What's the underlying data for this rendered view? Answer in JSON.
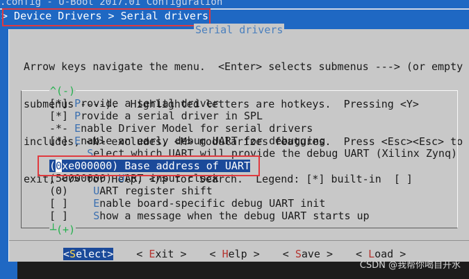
{
  "window": {
    "title": ".config - U-Boot 2017.01 Configuration",
    "breadcrumb": "> Device Drivers > Serial drivers"
  },
  "dialog": {
    "title": "Serial drivers",
    "help_lines": [
      "Arrow keys navigate the menu.  <Enter> selects submenus ---> (or empty",
      "submenus ----).  Highlighted letters are hotkeys.  Pressing <Y>",
      "includes, <N> excludes, <M> modularizes features.  Press <Esc><Esc> to",
      "exit, <?> for Help, </> for Search.  Legend: [*] built-in  [ ]"
    ],
    "scroll_up_marker": "^(-)",
    "scroll_down_marker": "┴(+)",
    "items": [
      {
        "prefix": "[*] ",
        "hotkey": "P",
        "rest": "rovide a serial driver",
        "selected": false
      },
      {
        "prefix": "[*] ",
        "hotkey": "P",
        "rest": "rovide a serial driver in SPL",
        "selected": false
      },
      {
        "prefix": "-*- ",
        "hotkey": "E",
        "rest": "nable Driver Model for serial drivers",
        "selected": false
      },
      {
        "prefix": "[*] ",
        "hotkey": "E",
        "rest": "nable an early debug UART for debugging",
        "selected": false
      },
      {
        "prefix": "      ",
        "hotkey": "S",
        "rest": "elect which UART will provide the debug UART (Xilinx Zynq)",
        "selected": false
      },
      {
        "prefix": "(",
        "cursor": "0",
        "prefix2": "xe000000) ",
        "hotkey": "B",
        "rest": "ase address of UART",
        "selected": true
      },
      {
        "prefix": "(50000000) ",
        "hotkey": "U",
        "rest": "ART input clock",
        "selected": false
      },
      {
        "prefix": "(0)    ",
        "hotkey": "U",
        "rest": "ART register shift",
        "selected": false
      },
      {
        "prefix": "[ ]    ",
        "hotkey": "E",
        "rest": "nable board-specific debug UART init",
        "selected": false
      },
      {
        "prefix": "[ ]    ",
        "hotkey": "S",
        "rest": "how a message when the debug UART starts up",
        "selected": false
      }
    ],
    "buttons": [
      {
        "lead": "<",
        "hot": "S",
        "rest": "elect>",
        "active": true
      },
      {
        "lead": "< ",
        "hot": "E",
        "rest": "xit >",
        "active": false
      },
      {
        "lead": "< ",
        "hot": "H",
        "rest": "elp >",
        "active": false
      },
      {
        "lead": "< ",
        "hot": "S",
        "rest": "ave >",
        "active": false
      },
      {
        "lead": "< ",
        "hot": "L",
        "rest": "oad >",
        "active": false
      }
    ]
  },
  "watermark": "CSDN @我帮你喝自开水",
  "colors": {
    "background": "#1f68c3",
    "dialog": "#c8c8c8",
    "selection": "#1b4a9a",
    "hotkey": "#3a6fb0",
    "annotation_box": "#e0393e"
  }
}
